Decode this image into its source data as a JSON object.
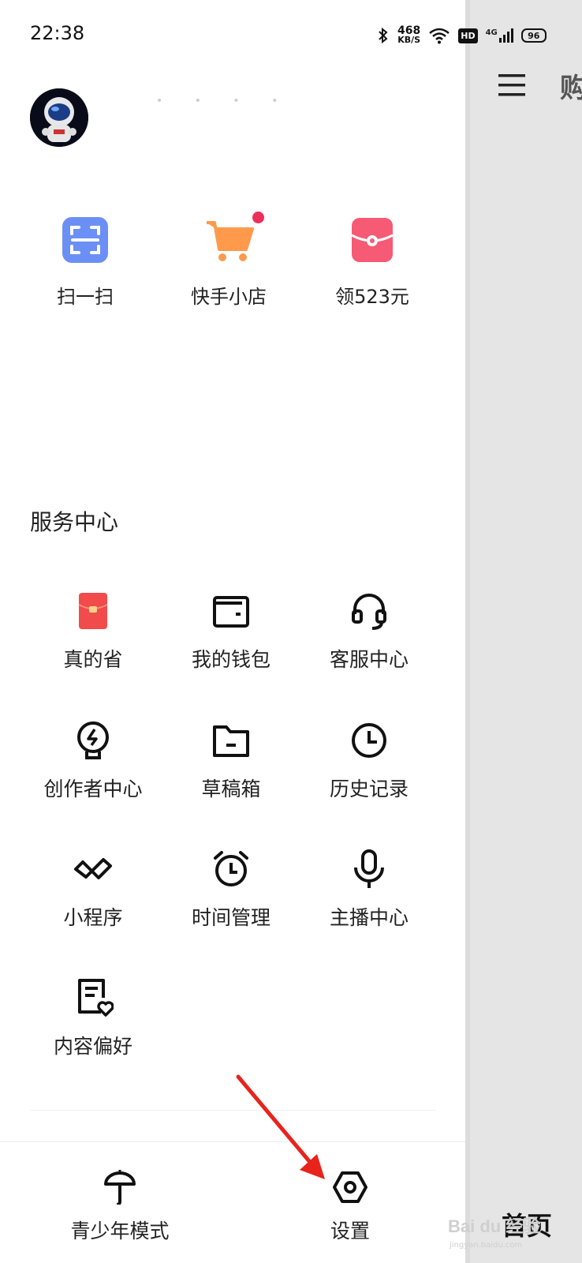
{
  "status_bar": {
    "time": "22:38",
    "net_speed_value": "468",
    "net_speed_unit": "KB/S",
    "hd_badge": "HD",
    "network_type": "4G",
    "battery_level": "96"
  },
  "right_panel": {
    "partial_title": "购",
    "bottom_label": "首页"
  },
  "quick_actions": [
    {
      "label": "扫一扫",
      "icon": "scan-icon",
      "color": "#6b8ff5"
    },
    {
      "label": "快手小店",
      "icon": "cart-icon",
      "color": "#ff9a4d",
      "has_dot": true
    },
    {
      "label": "领523元",
      "icon": "red-packet-icon",
      "color": "#f65a74"
    }
  ],
  "service_center": {
    "title": "服务中心",
    "items": [
      {
        "label": "真的省",
        "icon": "red-envelope-icon"
      },
      {
        "label": "我的钱包",
        "icon": "wallet-icon"
      },
      {
        "label": "客服中心",
        "icon": "headset-icon"
      },
      {
        "label": "创作者中心",
        "icon": "lightbulb-icon"
      },
      {
        "label": "草稿箱",
        "icon": "folder-icon"
      },
      {
        "label": "历史记录",
        "icon": "clock-icon"
      },
      {
        "label": "小程序",
        "icon": "mini-program-icon"
      },
      {
        "label": "时间管理",
        "icon": "alarm-clock-icon"
      },
      {
        "label": "主播中心",
        "icon": "microphone-icon"
      },
      {
        "label": "内容偏好",
        "icon": "document-heart-icon"
      }
    ]
  },
  "bottom_bar": {
    "youth_mode": "青少年模式",
    "settings": "设置"
  },
  "colors": {
    "accent_red": "#ea2f5a",
    "annotation_arrow": "#e8231c",
    "panel_gray": "#e5e5e5"
  },
  "watermark": {
    "brand": "Bai du 经验",
    "url": "jingyan.baidu.com"
  }
}
